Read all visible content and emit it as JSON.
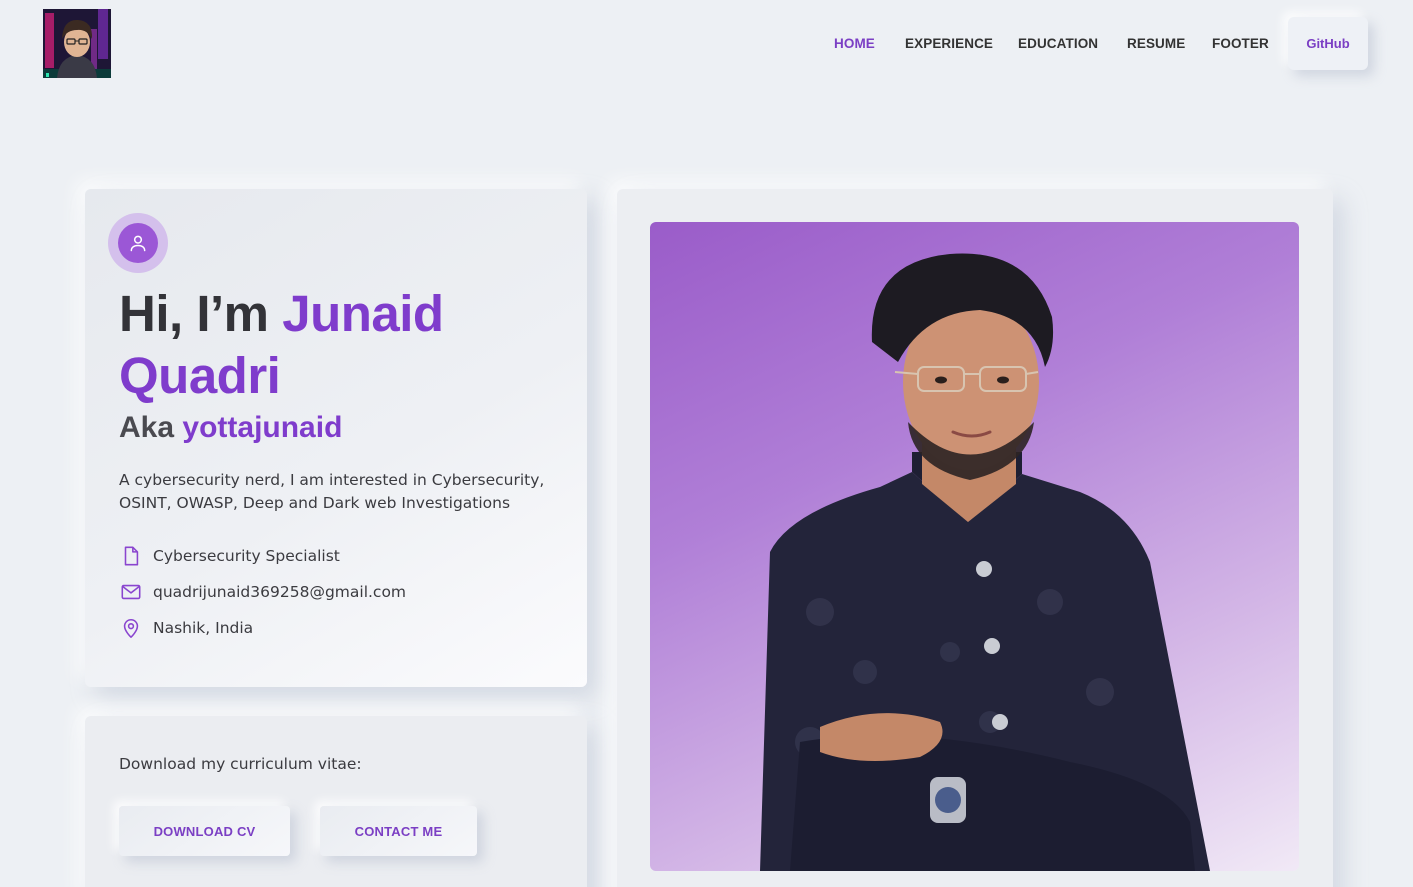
{
  "nav": {
    "links": [
      {
        "label": "HOME",
        "active": true
      },
      {
        "label": "EXPERIENCE",
        "active": false
      },
      {
        "label": "EDUCATION",
        "active": false
      },
      {
        "label": "RESUME",
        "active": false
      },
      {
        "label": "FOOTER",
        "active": false
      }
    ],
    "github_label": "GitHub"
  },
  "intro": {
    "greeting": "Hi, I’m",
    "first_name": "Junaid",
    "last_name": "Quadri",
    "aka_prefix": "Aka",
    "alias": "yottajunaid",
    "bio": "A cybersecurity nerd, I am interested in Cybersecurity, OSINT, OWASP, Deep and Dark web Investigations",
    "info": [
      {
        "icon": "document-icon",
        "text": "Cybersecurity Specialist"
      },
      {
        "icon": "mail-icon",
        "text": "quadrijunaid369258@gmail.com"
      },
      {
        "icon": "location-pin-icon",
        "text": "Nashik, India"
      }
    ]
  },
  "cv": {
    "label": "Download my curriculum vitae:",
    "download_label": "DOWNLOAD CV",
    "contact_label": "CONTACT ME"
  },
  "colors": {
    "accent": "#7f3ccc",
    "background": "#edf0f4",
    "text": "#333338"
  }
}
